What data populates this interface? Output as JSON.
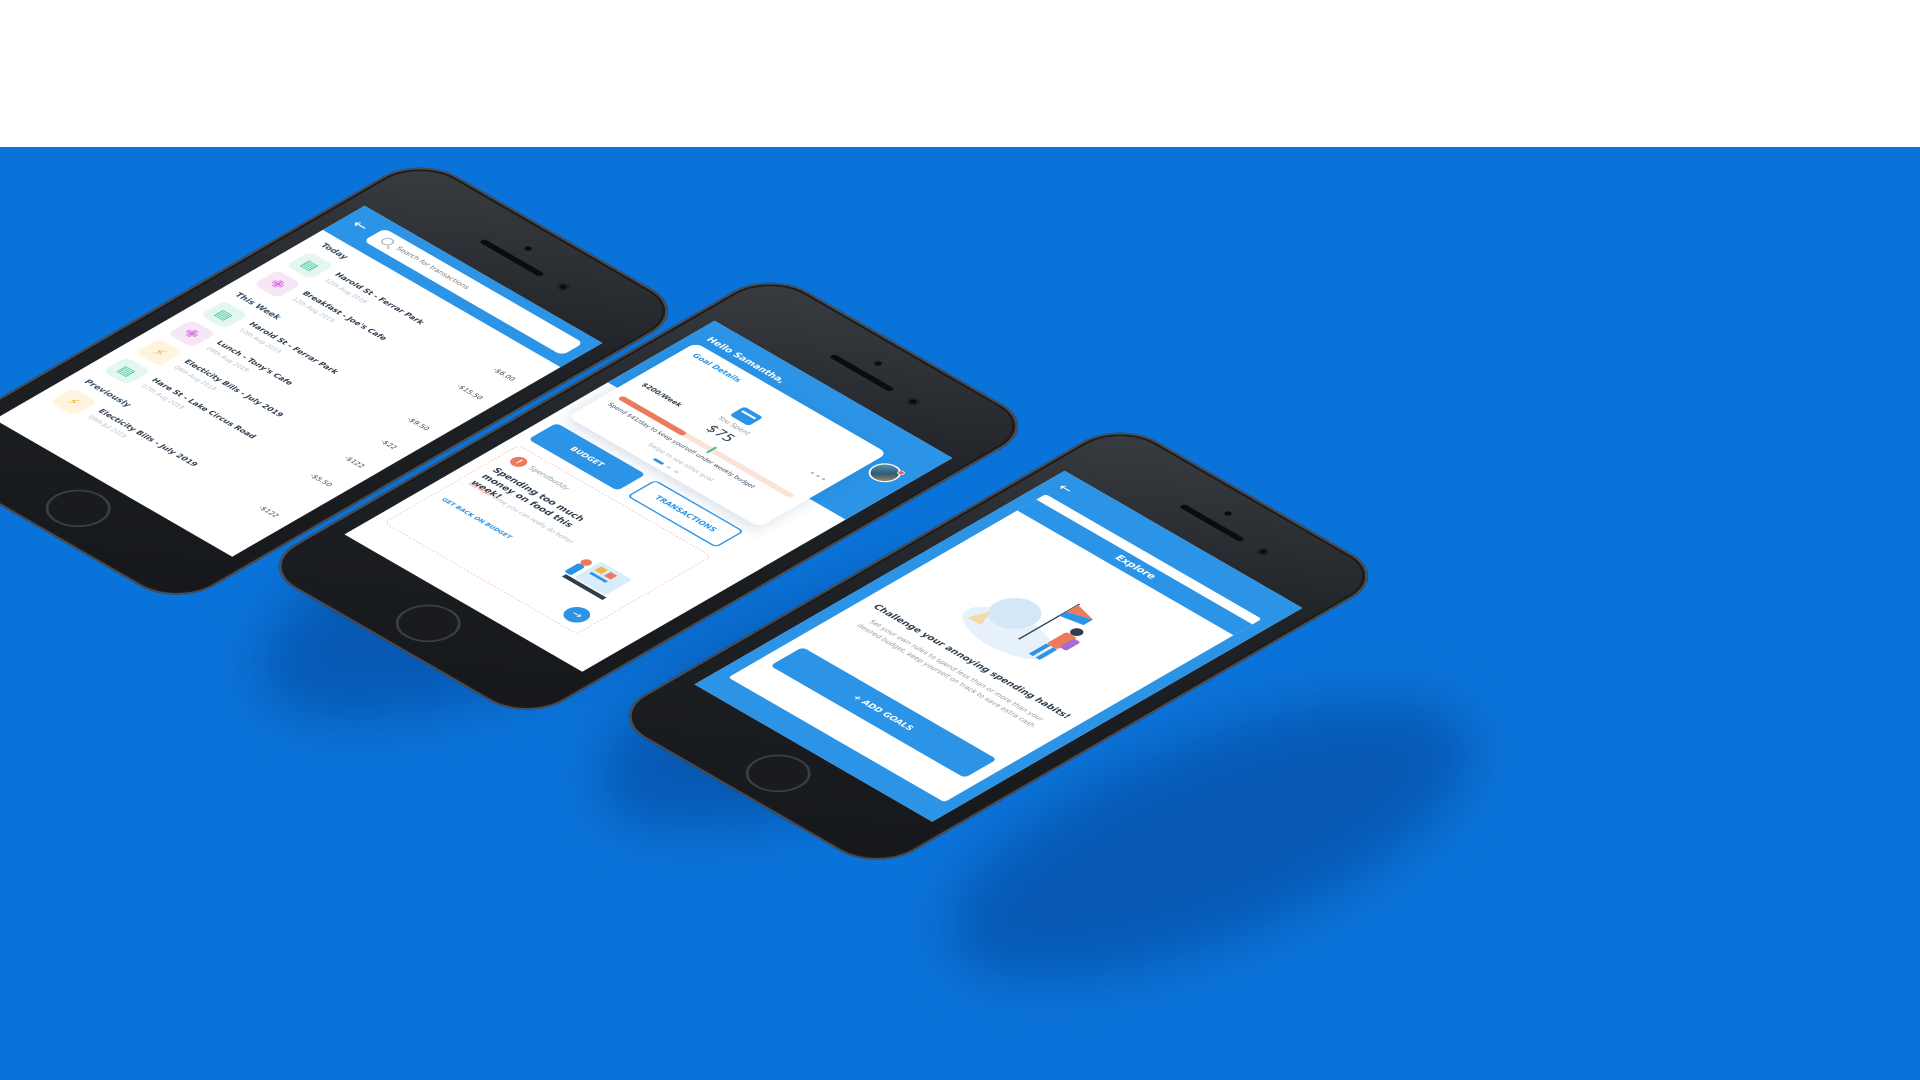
{
  "phone1": {
    "search": {
      "placeholder": "Search for transactions"
    },
    "sections": {
      "today": "Today",
      "this_week": "This Week",
      "previously": "Previously"
    },
    "today": [
      {
        "icon": "car-icon",
        "title": "Harold St - Ferrar Park",
        "date": "12th Aug 2019",
        "amount": "-$6.00"
      },
      {
        "icon": "cutlery-icon",
        "title": "Breakfast - Joe's Cafe",
        "date": "12th Aug 2019",
        "amount": "-$15.50"
      }
    ],
    "this_week": [
      {
        "icon": "car-icon",
        "title": "Harold St - Ferrar Park",
        "date": "10th Aug 2019",
        "amount": "-$9.50"
      },
      {
        "icon": "cutlery-icon",
        "title": "Lunch - Tony's Cafe",
        "date": "09th Aug 2019",
        "amount": "-$22"
      },
      {
        "icon": "bolt-icon",
        "title": "Electicity Bills - July 2019",
        "date": "08th Aug 2019",
        "amount": "-$122"
      },
      {
        "icon": "car-icon",
        "title": "Hare St - Lake Circus Road",
        "date": "07th Aug 2019",
        "amount": "-$5.50"
      }
    ],
    "previously": [
      {
        "icon": "bolt-icon",
        "title": "Electicity Bills - July 2019",
        "date": "08th Jul 2019",
        "amount": "-$122"
      }
    ]
  },
  "phone2": {
    "greeting": "Hello Samantha,",
    "goal_title": "Goal Details",
    "budget_rate": "$200/Week",
    "spent_label": "You Spent",
    "spent_value": "$75",
    "progress": 0.375,
    "tip": "Spend $41/day to keep yourself under weekly budget",
    "swipe_hint": "Swipe to see other goal",
    "budget_button": "BUDGET",
    "transactions_button": "TRANSACTIONS",
    "alert": {
      "tag": "Spendbuddy",
      "title": "Spending too much money on food this week!",
      "sub_highlight": "Uh-huh!",
      "sub_rest": " Time you can really do better",
      "link": "GET BACK ON BUDGET"
    }
  },
  "phone3": {
    "title": "Explore",
    "headline": "Challenge your annoying spending habits!",
    "body": "Set your own rules to spend less than or more than your desired budget, keep yourself on track to save extra cash.",
    "button": "+ ADD GOALS"
  },
  "colors": {
    "background_blue": "#0a73d9",
    "app_blue": "#2b94e6",
    "accent_orange": "#ec7a5c",
    "accent_green": "#3ec49a"
  }
}
